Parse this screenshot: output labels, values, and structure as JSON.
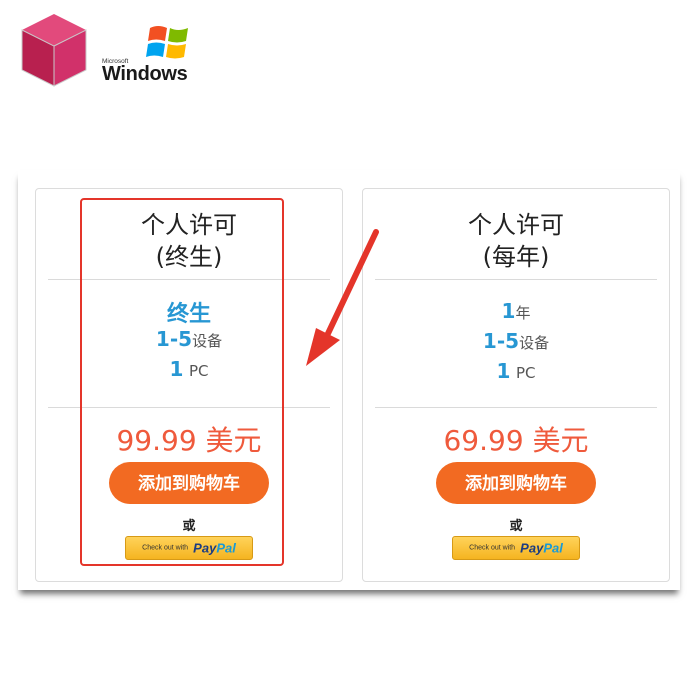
{
  "logos": {
    "windows_small": "Microsoft",
    "windows_text": "Windows"
  },
  "cards": [
    {
      "title_line1": "个人许可",
      "title_line2": "(终生)",
      "feature1": "终生",
      "feature2_num": "1-5",
      "feature2_unit": "设备",
      "feature3_num": "1",
      "feature3_unit": "PC",
      "price": "99.99 美元",
      "cart_button": "添加到购物车",
      "or_label": "或",
      "paypal_small": "Check out with",
      "paypal_pay": "Pay",
      "paypal_pal": "Pal"
    },
    {
      "title_line1": "个人许可",
      "title_line2": "(每年)",
      "feature1_num": "1",
      "feature1_unit": "年",
      "feature2_num": "1-5",
      "feature2_unit": "设备",
      "feature3_num": "1",
      "feature3_unit": "PC",
      "price": "69.99 美元",
      "cart_button": "添加到购物车",
      "or_label": "或",
      "paypal_small": "Check out with",
      "paypal_pay": "Pay",
      "paypal_pal": "Pal"
    }
  ],
  "colors": {
    "accent_blue": "#2797d3",
    "price_red": "#ef5a3c",
    "cart_orange": "#f26a22",
    "highlight_red": "#e4352a"
  }
}
